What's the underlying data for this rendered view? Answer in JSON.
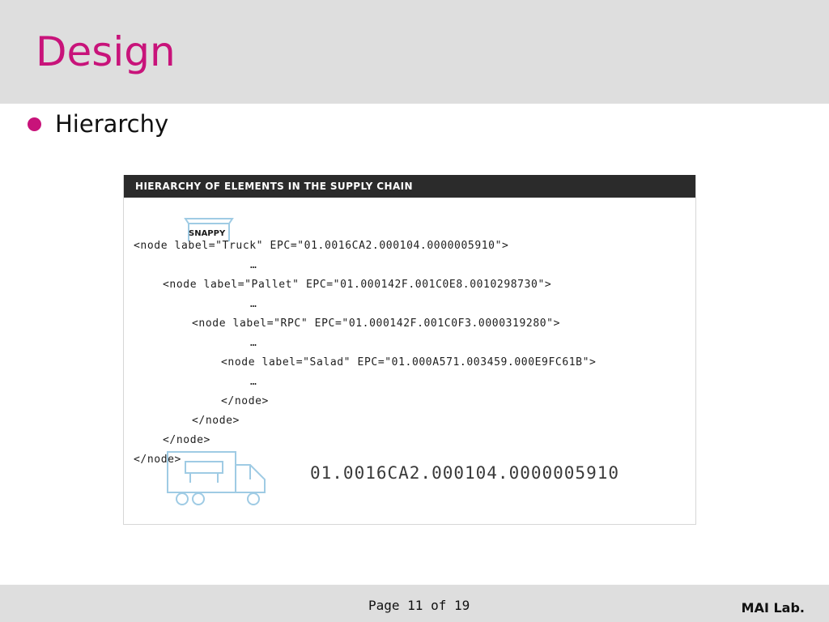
{
  "slide": {
    "title": "Design",
    "bullet": "Hierarchy"
  },
  "figure": {
    "header": "HIERARCHY OF ELEMENTS IN THE SUPPLY CHAIN",
    "pallet_label": "SNAPPY",
    "epc_large": "01.0016CA2.000104.0000005910",
    "code_lines": [
      "<node label=\"Truck\" EPC=\"01.0016CA2.000104.0000005910\">",
      "…",
      "<node label=\"Pallet\" EPC=\"01.000142F.001C0E8.0010298730\">",
      "…",
      "<node label=\"RPC\" EPC=\"01.000142F.001C0F3.0000319280\">",
      "…",
      "<node label=\"Salad\" EPC=\"01.000A571.003459.000E9FC61B\">",
      "…",
      "</node>",
      "</node>",
      "</node>",
      "</node>"
    ]
  },
  "footer": {
    "page": "Page 11 of 19",
    "lab": "MAI Lab."
  },
  "colors": {
    "accent": "#c8137a",
    "bar_gray": "#dedede",
    "figure_header": "#2b2b2b",
    "illustration_blue": "#9fcbe4"
  }
}
